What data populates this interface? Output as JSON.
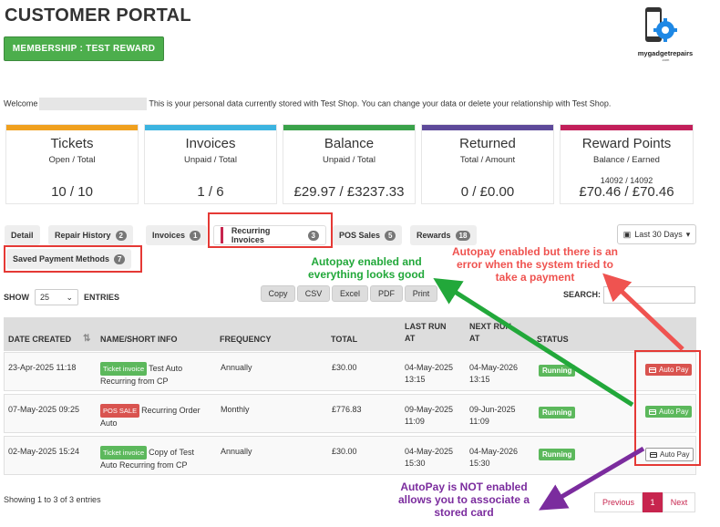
{
  "header": {
    "title": "CUSTOMER PORTAL",
    "membership_label": "MEMBERSHIP : TEST REWARD",
    "logo_text": "mygadgetrepairs",
    "logo_domain": ".com"
  },
  "welcome": {
    "prefix": "Welcome",
    "text": "This is your personal data currently stored with Test Shop. You can change your data or delete your relationship with Test Shop."
  },
  "cards": [
    {
      "title": "Tickets",
      "sub": "Open / Total",
      "value": "10 / 10",
      "color": "#f0a01e"
    },
    {
      "title": "Invoices",
      "sub": "Unpaid / Total",
      "value": "1 / 6",
      "color": "#3cb4e0"
    },
    {
      "title": "Balance",
      "sub": "Unpaid / Total",
      "value": "£29.97 / £3237.33",
      "color": "#3aa24a"
    },
    {
      "title": "Returned",
      "sub": "Total / Amount",
      "value": "0 / £0.00",
      "color": "#5e4a9a"
    },
    {
      "title": "Reward Points",
      "sub": "Balance / Earned",
      "small": "14092 / 14092",
      "value": "£70.46 / £70.46",
      "color": "#c21f5a"
    }
  ],
  "tabs": [
    {
      "label": "Detail"
    },
    {
      "label": "Repair History",
      "count": "2"
    },
    {
      "label": "Invoices",
      "count": "1"
    },
    {
      "label": "Recurring Invoices",
      "count": "3"
    },
    {
      "label": "POS Sales",
      "count": "5"
    },
    {
      "label": "Rewards",
      "count": "18"
    },
    {
      "label": "Saved Payment Methods",
      "count": "7"
    }
  ],
  "date_filter": "Last 30 Days",
  "table_controls": {
    "show": "SHOW",
    "page_size": "25",
    "entries": "ENTRIES",
    "search": "SEARCH:",
    "buttons": [
      "Copy",
      "CSV",
      "Excel",
      "PDF",
      "Print"
    ]
  },
  "columns": [
    "DATE CREATED",
    "NAME/SHORT INFO",
    "FREQUENCY",
    "TOTAL",
    "LAST RUN AT",
    "NEXT RUN AT",
    "STATUS"
  ],
  "rows": [
    {
      "date": "23-Apr-2025 11:18",
      "tag": "Ticket invoice",
      "tag_color": "green",
      "name": "Test Auto Recurring from CP",
      "freq": "Annually",
      "total": "£30.00",
      "last": "04-May-2025 13:15",
      "next": "04-May-2026 13:15",
      "status": "Running",
      "autopay": "Auto Pay"
    },
    {
      "date": "07-May-2025 09:25",
      "tag": "POS SALE",
      "tag_color": "red",
      "name": "Recurring Order Auto",
      "freq": "Monthly",
      "total": "£776.83",
      "last": "09-May-2025 11:09",
      "next": "09-Jun-2025 11:09",
      "status": "Running",
      "autopay": "Auto Pay"
    },
    {
      "date": "02-May-2025 15:24",
      "tag": "Ticket invoice",
      "tag_color": "green",
      "name": "Copy of Test Auto Recurring from CP",
      "freq": "Annually",
      "total": "£30.00",
      "last": "04-May-2025 15:30",
      "next": "04-May-2026 15:30",
      "status": "Running",
      "autopay": "Auto Pay"
    }
  ],
  "footer": {
    "entries_text": "Showing 1 to 3 of 3 entries",
    "prev": "Previous",
    "page": "1",
    "next": "Next"
  },
  "annotations": {
    "green": "Autopay enabled and everything looks good",
    "red": "Autopay enabled but there is an error when the system tried to take a payment",
    "purple": "AutoPay is NOT enabled allows you to associate a stored card"
  }
}
